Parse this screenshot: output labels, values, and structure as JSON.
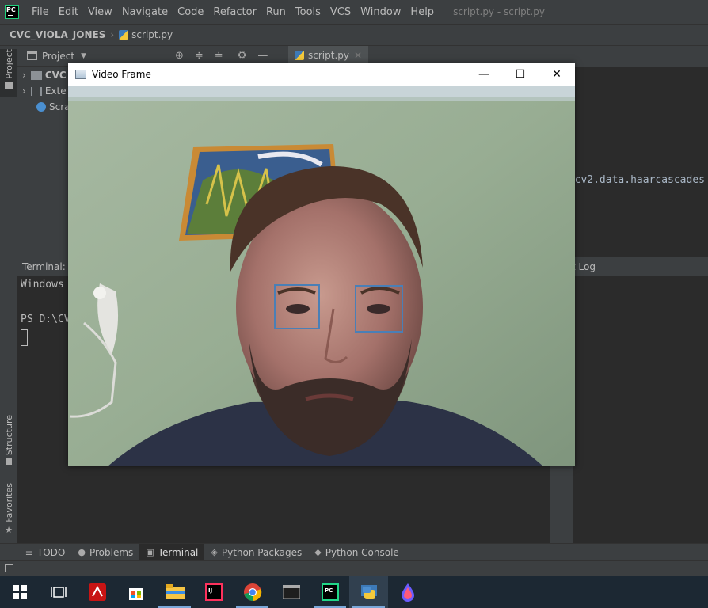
{
  "menubar": {
    "items": [
      "File",
      "Edit",
      "View",
      "Navigate",
      "Code",
      "Refactor",
      "Run",
      "Tools",
      "VCS",
      "Window",
      "Help"
    ],
    "window_title": "script.py - script.py"
  },
  "navbar": {
    "project": "CVC_VIOLA_JONES",
    "file": "script.py"
  },
  "sidebar": {
    "project_tab": "Project",
    "structure_tab": "Structure",
    "favorites_tab": "Favorites"
  },
  "project_panel": {
    "title": "Project",
    "items": [
      "CVC",
      "Exte",
      "Scra"
    ]
  },
  "editor": {
    "tab": "script.py",
    "code_fragment": "cv2.data.haarcascades"
  },
  "terminal": {
    "label": "Terminal:",
    "line1": "Windows",
    "line2": "PS D:\\CV"
  },
  "run_panel": {
    "label": "t Log"
  },
  "bottom_tabs": [
    "TODO",
    "Problems",
    "Terminal",
    "Python Packages",
    "Python Console"
  ],
  "video_window": {
    "title": "Video Frame"
  },
  "colors": {
    "ide_bg": "#2b2b2b",
    "panel_bg": "#3c3f41",
    "detection_box": "#4a7fb6",
    "taskbar": "#1c2833"
  }
}
